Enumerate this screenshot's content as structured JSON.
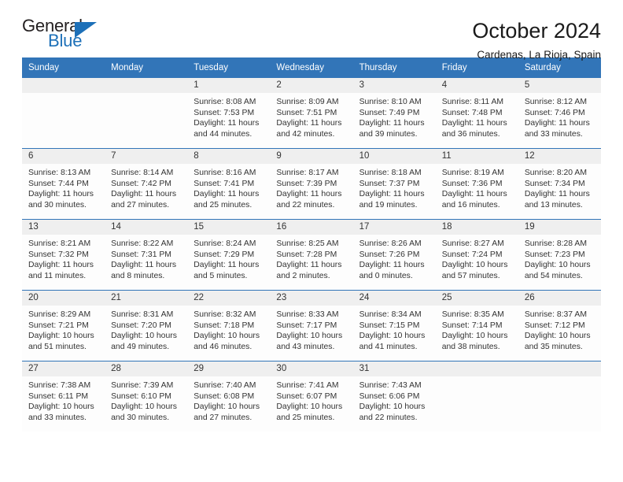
{
  "brand": {
    "name_top": "General",
    "name_bottom": "Blue",
    "accent_color": "#1d70b8"
  },
  "header": {
    "title": "October 2024",
    "location": "Cardenas, La Rioja, Spain"
  },
  "calendar": {
    "header_background": "#3275b8",
    "day_band_background": "#efefef",
    "weekdays": [
      "Sunday",
      "Monday",
      "Tuesday",
      "Wednesday",
      "Thursday",
      "Friday",
      "Saturday"
    ],
    "weeks": [
      [
        {
          "date": "",
          "sunrise": "",
          "sunset": "",
          "daylight_line1": "",
          "daylight_line2": ""
        },
        {
          "date": "",
          "sunrise": "",
          "sunset": "",
          "daylight_line1": "",
          "daylight_line2": ""
        },
        {
          "date": "1",
          "sunrise": "Sunrise: 8:08 AM",
          "sunset": "Sunset: 7:53 PM",
          "daylight_line1": "Daylight: 11 hours",
          "daylight_line2": "and 44 minutes."
        },
        {
          "date": "2",
          "sunrise": "Sunrise: 8:09 AM",
          "sunset": "Sunset: 7:51 PM",
          "daylight_line1": "Daylight: 11 hours",
          "daylight_line2": "and 42 minutes."
        },
        {
          "date": "3",
          "sunrise": "Sunrise: 8:10 AM",
          "sunset": "Sunset: 7:49 PM",
          "daylight_line1": "Daylight: 11 hours",
          "daylight_line2": "and 39 minutes."
        },
        {
          "date": "4",
          "sunrise": "Sunrise: 8:11 AM",
          "sunset": "Sunset: 7:48 PM",
          "daylight_line1": "Daylight: 11 hours",
          "daylight_line2": "and 36 minutes."
        },
        {
          "date": "5",
          "sunrise": "Sunrise: 8:12 AM",
          "sunset": "Sunset: 7:46 PM",
          "daylight_line1": "Daylight: 11 hours",
          "daylight_line2": "and 33 minutes."
        }
      ],
      [
        {
          "date": "6",
          "sunrise": "Sunrise: 8:13 AM",
          "sunset": "Sunset: 7:44 PM",
          "daylight_line1": "Daylight: 11 hours",
          "daylight_line2": "and 30 minutes."
        },
        {
          "date": "7",
          "sunrise": "Sunrise: 8:14 AM",
          "sunset": "Sunset: 7:42 PM",
          "daylight_line1": "Daylight: 11 hours",
          "daylight_line2": "and 27 minutes."
        },
        {
          "date": "8",
          "sunrise": "Sunrise: 8:16 AM",
          "sunset": "Sunset: 7:41 PM",
          "daylight_line1": "Daylight: 11 hours",
          "daylight_line2": "and 25 minutes."
        },
        {
          "date": "9",
          "sunrise": "Sunrise: 8:17 AM",
          "sunset": "Sunset: 7:39 PM",
          "daylight_line1": "Daylight: 11 hours",
          "daylight_line2": "and 22 minutes."
        },
        {
          "date": "10",
          "sunrise": "Sunrise: 8:18 AM",
          "sunset": "Sunset: 7:37 PM",
          "daylight_line1": "Daylight: 11 hours",
          "daylight_line2": "and 19 minutes."
        },
        {
          "date": "11",
          "sunrise": "Sunrise: 8:19 AM",
          "sunset": "Sunset: 7:36 PM",
          "daylight_line1": "Daylight: 11 hours",
          "daylight_line2": "and 16 minutes."
        },
        {
          "date": "12",
          "sunrise": "Sunrise: 8:20 AM",
          "sunset": "Sunset: 7:34 PM",
          "daylight_line1": "Daylight: 11 hours",
          "daylight_line2": "and 13 minutes."
        }
      ],
      [
        {
          "date": "13",
          "sunrise": "Sunrise: 8:21 AM",
          "sunset": "Sunset: 7:32 PM",
          "daylight_line1": "Daylight: 11 hours",
          "daylight_line2": "and 11 minutes."
        },
        {
          "date": "14",
          "sunrise": "Sunrise: 8:22 AM",
          "sunset": "Sunset: 7:31 PM",
          "daylight_line1": "Daylight: 11 hours",
          "daylight_line2": "and 8 minutes."
        },
        {
          "date": "15",
          "sunrise": "Sunrise: 8:24 AM",
          "sunset": "Sunset: 7:29 PM",
          "daylight_line1": "Daylight: 11 hours",
          "daylight_line2": "and 5 minutes."
        },
        {
          "date": "16",
          "sunrise": "Sunrise: 8:25 AM",
          "sunset": "Sunset: 7:28 PM",
          "daylight_line1": "Daylight: 11 hours",
          "daylight_line2": "and 2 minutes."
        },
        {
          "date": "17",
          "sunrise": "Sunrise: 8:26 AM",
          "sunset": "Sunset: 7:26 PM",
          "daylight_line1": "Daylight: 11 hours",
          "daylight_line2": "and 0 minutes."
        },
        {
          "date": "18",
          "sunrise": "Sunrise: 8:27 AM",
          "sunset": "Sunset: 7:24 PM",
          "daylight_line1": "Daylight: 10 hours",
          "daylight_line2": "and 57 minutes."
        },
        {
          "date": "19",
          "sunrise": "Sunrise: 8:28 AM",
          "sunset": "Sunset: 7:23 PM",
          "daylight_line1": "Daylight: 10 hours",
          "daylight_line2": "and 54 minutes."
        }
      ],
      [
        {
          "date": "20",
          "sunrise": "Sunrise: 8:29 AM",
          "sunset": "Sunset: 7:21 PM",
          "daylight_line1": "Daylight: 10 hours",
          "daylight_line2": "and 51 minutes."
        },
        {
          "date": "21",
          "sunrise": "Sunrise: 8:31 AM",
          "sunset": "Sunset: 7:20 PM",
          "daylight_line1": "Daylight: 10 hours",
          "daylight_line2": "and 49 minutes."
        },
        {
          "date": "22",
          "sunrise": "Sunrise: 8:32 AM",
          "sunset": "Sunset: 7:18 PM",
          "daylight_line1": "Daylight: 10 hours",
          "daylight_line2": "and 46 minutes."
        },
        {
          "date": "23",
          "sunrise": "Sunrise: 8:33 AM",
          "sunset": "Sunset: 7:17 PM",
          "daylight_line1": "Daylight: 10 hours",
          "daylight_line2": "and 43 minutes."
        },
        {
          "date": "24",
          "sunrise": "Sunrise: 8:34 AM",
          "sunset": "Sunset: 7:15 PM",
          "daylight_line1": "Daylight: 10 hours",
          "daylight_line2": "and 41 minutes."
        },
        {
          "date": "25",
          "sunrise": "Sunrise: 8:35 AM",
          "sunset": "Sunset: 7:14 PM",
          "daylight_line1": "Daylight: 10 hours",
          "daylight_line2": "and 38 minutes."
        },
        {
          "date": "26",
          "sunrise": "Sunrise: 8:37 AM",
          "sunset": "Sunset: 7:12 PM",
          "daylight_line1": "Daylight: 10 hours",
          "daylight_line2": "and 35 minutes."
        }
      ],
      [
        {
          "date": "27",
          "sunrise": "Sunrise: 7:38 AM",
          "sunset": "Sunset: 6:11 PM",
          "daylight_line1": "Daylight: 10 hours",
          "daylight_line2": "and 33 minutes."
        },
        {
          "date": "28",
          "sunrise": "Sunrise: 7:39 AM",
          "sunset": "Sunset: 6:10 PM",
          "daylight_line1": "Daylight: 10 hours",
          "daylight_line2": "and 30 minutes."
        },
        {
          "date": "29",
          "sunrise": "Sunrise: 7:40 AM",
          "sunset": "Sunset: 6:08 PM",
          "daylight_line1": "Daylight: 10 hours",
          "daylight_line2": "and 27 minutes."
        },
        {
          "date": "30",
          "sunrise": "Sunrise: 7:41 AM",
          "sunset": "Sunset: 6:07 PM",
          "daylight_line1": "Daylight: 10 hours",
          "daylight_line2": "and 25 minutes."
        },
        {
          "date": "31",
          "sunrise": "Sunrise: 7:43 AM",
          "sunset": "Sunset: 6:06 PM",
          "daylight_line1": "Daylight: 10 hours",
          "daylight_line2": "and 22 minutes."
        },
        {
          "date": "",
          "sunrise": "",
          "sunset": "",
          "daylight_line1": "",
          "daylight_line2": ""
        },
        {
          "date": "",
          "sunrise": "",
          "sunset": "",
          "daylight_line1": "",
          "daylight_line2": ""
        }
      ]
    ]
  }
}
